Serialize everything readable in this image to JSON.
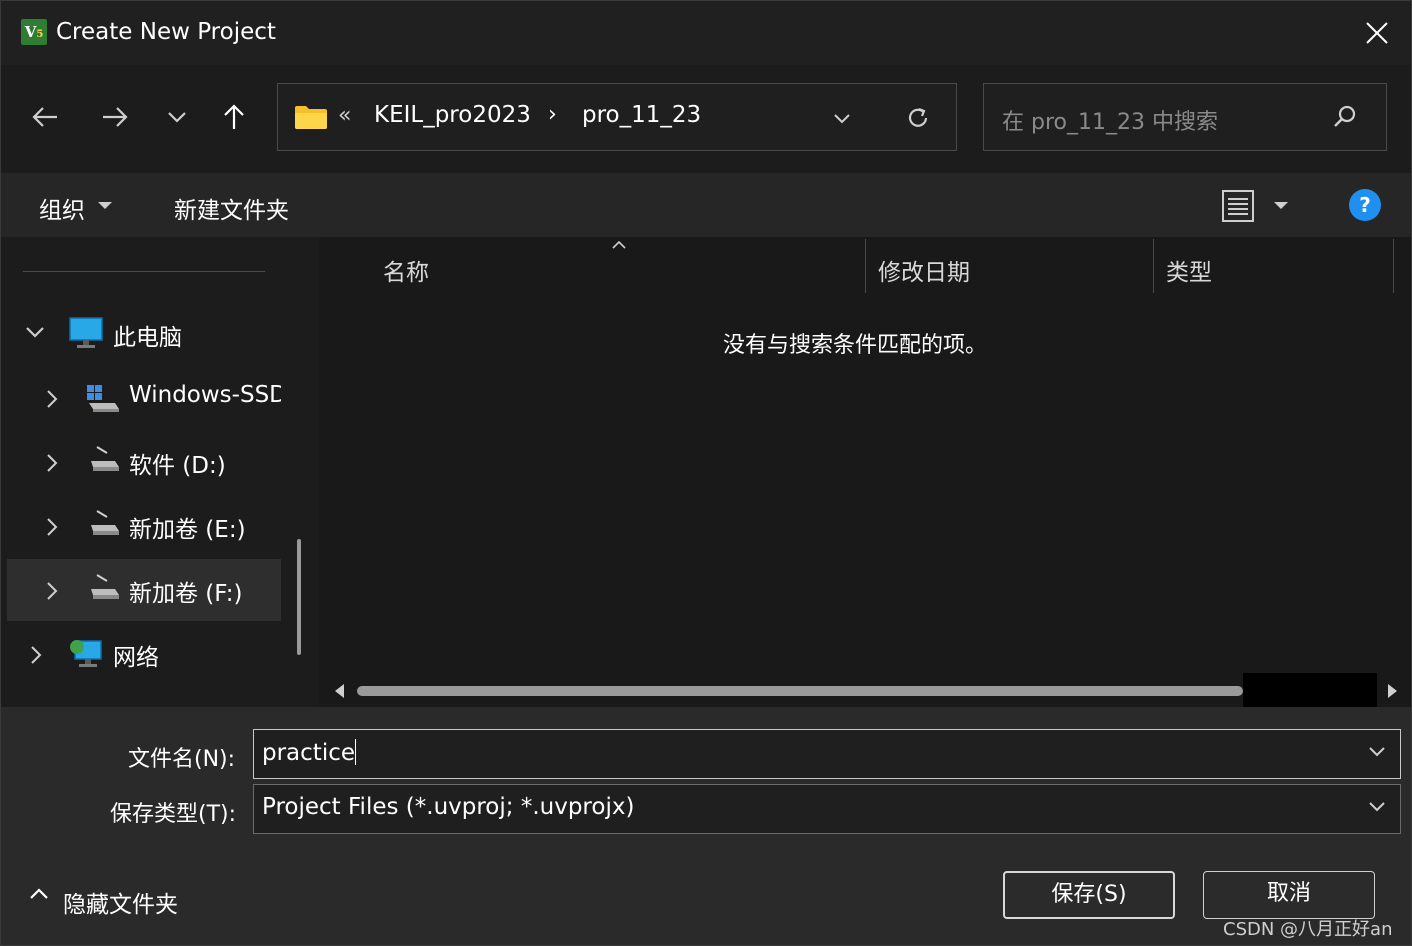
{
  "window": {
    "title": "Create New Project",
    "app_icon_letter": "V",
    "app_icon_sub": "5"
  },
  "address": {
    "overflow": "«",
    "segments": [
      "KEIL_pro2023",
      "pro_11_23"
    ],
    "separator": "›"
  },
  "search": {
    "placeholder": "在 pro_11_23 中搜索"
  },
  "toolbar": {
    "organize_label": "组织",
    "new_folder_label": "新建文件夹",
    "help_symbol": "?"
  },
  "sidebar": {
    "items": [
      {
        "label": "此电脑"
      },
      {
        "label": "Windows-SSD"
      },
      {
        "label": "软件 (D:)"
      },
      {
        "label": "新加卷 (E:)"
      },
      {
        "label": "新加卷 (F:)"
      },
      {
        "label": "网络"
      }
    ]
  },
  "content": {
    "columns": [
      "名称",
      "修改日期",
      "类型"
    ],
    "empty_message": "没有与搜索条件匹配的项。"
  },
  "form": {
    "filename_label": "文件名(N):",
    "filename_value": "practice",
    "filetype_label": "保存类型(T):",
    "filetype_value": "Project Files (*.uvproj; *.uvprojx)"
  },
  "footer": {
    "hide_folders_label": "隐藏文件夹",
    "save_label": "保存(S)",
    "cancel_label": "取消",
    "watermark": "CSDN @八月正好an"
  },
  "colors": {
    "accent": "#1f8ff0",
    "background": "#191919"
  }
}
